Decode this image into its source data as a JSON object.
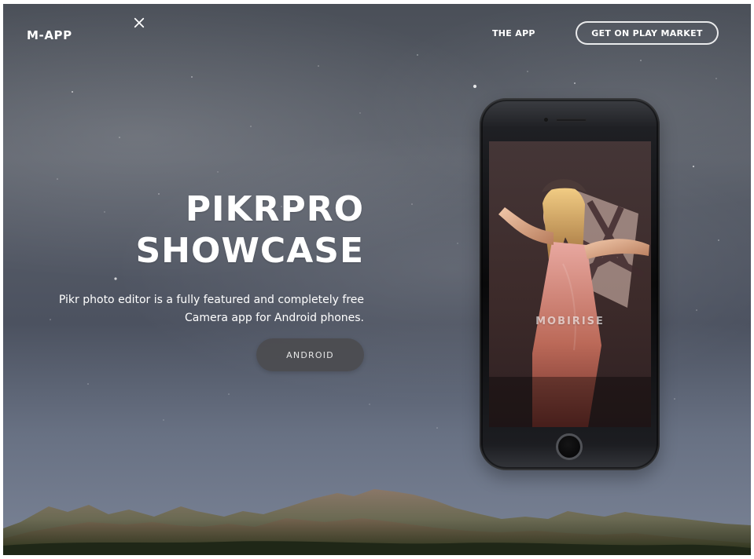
{
  "header": {
    "brand": "M-APP",
    "close_icon": "close-icon",
    "nav_link": "THE APP",
    "market_button": "GET ON PLAY MARKET"
  },
  "hero": {
    "title_line_1": "PIKRPRO",
    "title_line_2": "SHOWCASE",
    "description_line_1": "Pikr photo editor is a fully featured and completely free",
    "description_line_2": "Camera app for Android phones.",
    "button": "ANDROID"
  },
  "phone": {
    "screen_watermark": "MOBIRISE",
    "icon": "smartphone-mockup"
  },
  "colors": {
    "sky_dark": "#4b5059",
    "sky_light": "#7a8396",
    "button_dark": "#4c4c50",
    "white": "#ffffff"
  }
}
